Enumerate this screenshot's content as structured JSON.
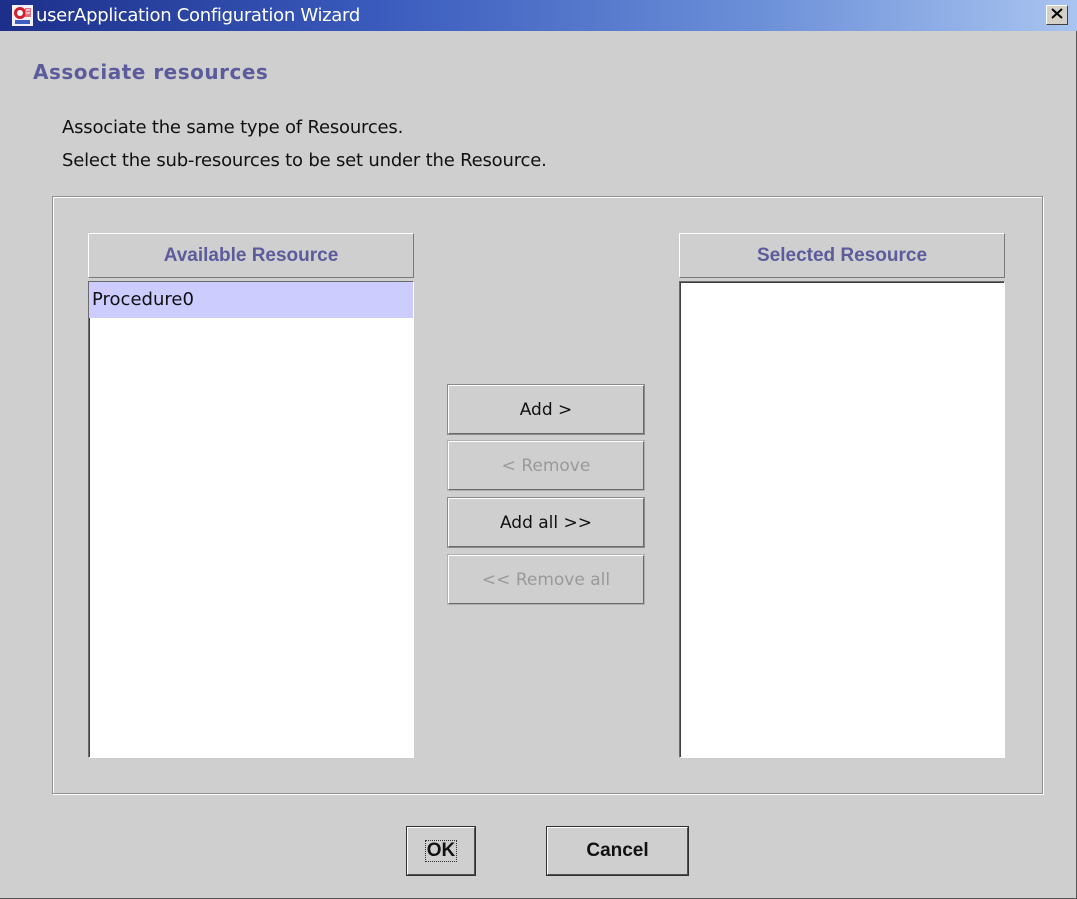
{
  "window": {
    "title": "userApplication Configuration Wizard",
    "app_icon": "wizard-app-icon",
    "close_icon": "close-x-icon"
  },
  "page": {
    "title": "Associate resources",
    "description_line1": "Associate the same type of Resources.",
    "description_line2": "Select the sub-resources to be set under the Resource."
  },
  "available": {
    "header": "Available Resource",
    "items": [
      {
        "label": "Procedure0",
        "selected": true
      }
    ]
  },
  "selected": {
    "header": "Selected Resource",
    "items": []
  },
  "actions": {
    "add_label": "Add >",
    "remove_label": "< Remove",
    "add_all_label": "Add all >>",
    "remove_all_label": "<< Remove all"
  },
  "footer": {
    "ok_label": "OK",
    "cancel_label": "Cancel"
  },
  "colors": {
    "accent_text": "#5c5c9c",
    "selection": "#ccccff",
    "title_gradient_start": "#1c2f8a",
    "title_gradient_end": "#a9c4f0"
  }
}
